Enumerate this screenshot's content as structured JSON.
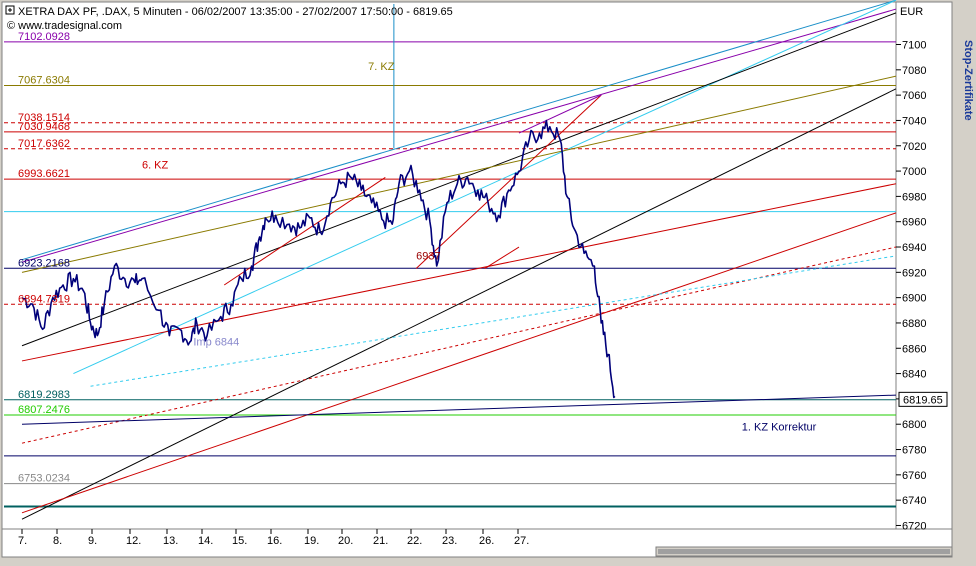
{
  "header": {
    "title": "XETRA DAX PF, .DAX, 5 Minuten - 06/02/2007 13:35:00 - 27/02/2007 17:50:00 - 6819.65",
    "source": "© www.tradesignal.com"
  },
  "side_title": "Stop-Zertifikate",
  "colors": {
    "plot_bg": "#ffffff",
    "price": "#00007a",
    "channel_blue": "#1a8fc8",
    "purple": "#8800aa",
    "cyan": "#33ccee",
    "olive": "#8a7a00",
    "red": "#cc0000",
    "dark_red": "#990000",
    "green": "#22cc00",
    "teal": "#006060",
    "navy": "#000066",
    "black": "#000000"
  },
  "chart_data": {
    "type": "line",
    "title": "XETRA DAX PF, .DAX, 5 Minuten - 06/02/2007 13:35:00 - 27/02/2007 17:50:00 - 6819.65",
    "ylabel": "EUR",
    "ylim": [
      6718,
      7132
    ],
    "y_ticks": [
      6720,
      6740,
      6760,
      6780,
      6800,
      6820,
      6840,
      6860,
      6880,
      6900,
      6920,
      6940,
      6960,
      6980,
      7000,
      7020,
      7040,
      7060,
      7080,
      7100
    ],
    "x_ticks": [
      "7.",
      "8.",
      "9.",
      "12.",
      "13.",
      "14.",
      "15.",
      "16.",
      "19.",
      "20.",
      "21.",
      "22.",
      "23.",
      "26.",
      "27."
    ],
    "x_range": [
      0,
      25.5
    ],
    "last_value_label": "6819.65",
    "price_series": {
      "name": ".DAX",
      "points": [
        [
          0,
          6900
        ],
        [
          0.3,
          6895
        ],
        [
          0.6,
          6875
        ],
        [
          0.9,
          6900
        ],
        [
          1.2,
          6910
        ],
        [
          1.5,
          6915
        ],
        [
          1.8,
          6905
        ],
        [
          2.0,
          6880
        ],
        [
          2.2,
          6870
        ],
        [
          2.4,
          6895
        ],
        [
          2.7,
          6925
        ],
        [
          3.0,
          6915
        ],
        [
          3.3,
          6912
        ],
        [
          3.5,
          6915
        ],
        [
          4.0,
          6890
        ],
        [
          4.3,
          6870
        ],
        [
          4.6,
          6875
        ],
        [
          4.9,
          6865
        ],
        [
          5.1,
          6880
        ],
        [
          5.4,
          6870
        ],
        [
          5.8,
          6885
        ],
        [
          6.1,
          6895
        ],
        [
          6.4,
          6915
        ],
        [
          6.7,
          6925
        ],
        [
          6.9,
          6945
        ],
        [
          7.1,
          6963
        ],
        [
          7.4,
          6965
        ],
        [
          7.8,
          6958
        ],
        [
          8.1,
          6955
        ],
        [
          8.4,
          6963
        ],
        [
          8.7,
          6952
        ],
        [
          9.0,
          6975
        ],
        [
          9.3,
          6990
        ],
        [
          9.6,
          6995
        ],
        [
          9.9,
          6985
        ],
        [
          10.2,
          6975
        ],
        [
          10.5,
          6962
        ],
        [
          10.8,
          6958
        ],
        [
          11.0,
          6990
        ],
        [
          11.3,
          7000
        ],
        [
          11.6,
          6985
        ],
        [
          11.9,
          6960
        ],
        [
          12.1,
          6925
        ],
        [
          12.4,
          6975
        ],
        [
          12.7,
          6990
        ],
        [
          13.0,
          6995
        ],
        [
          13.3,
          6985
        ],
        [
          13.6,
          6975
        ],
        [
          13.9,
          6965
        ],
        [
          14.2,
          6985
        ],
        [
          14.5,
          7000
        ],
        [
          14.8,
          7025
        ],
        [
          15.1,
          7030
        ],
        [
          15.4,
          7035
        ],
        [
          15.7,
          7025
        ],
        [
          15.9,
          6980
        ],
        [
          16.1,
          6955
        ],
        [
          16.4,
          6935
        ],
        [
          16.7,
          6925
        ],
        [
          16.9,
          6880
        ],
        [
          17.1,
          6855
        ],
        [
          17.3,
          6822
        ]
      ]
    },
    "horizontal_levels": [
      {
        "label": "7102.0928",
        "value": 7102.0928,
        "color": "#8800aa"
      },
      {
        "label": "7067.6304",
        "value": 7067.6304,
        "color": "#8a7a00"
      },
      {
        "label": "7038.1514",
        "value": 7038.1514,
        "color": "#cc0000",
        "dashed": true
      },
      {
        "label": "7030.9468",
        "value": 7030.9468,
        "color": "#cc0000"
      },
      {
        "label": "7017.6362",
        "value": 7017.6362,
        "color": "#cc0000",
        "dashed": true
      },
      {
        "label": "6993.6621",
        "value": 6993.6621,
        "color": "#cc0000"
      },
      {
        "label": "",
        "value": 6968,
        "color": "#33ccee"
      },
      {
        "label": "6923.2168",
        "value": 6923.2168,
        "color": "#000066"
      },
      {
        "label": "6894.7319",
        "value": 6894.7319,
        "color": "#cc0000",
        "dashed": true
      },
      {
        "label": "6819.2983",
        "value": 6819.2983,
        "color": "#006060"
      },
      {
        "label": "6807.2476",
        "value": 6807.2476,
        "color": "#22cc00"
      },
      {
        "label": "",
        "value": 6775,
        "color": "#000066"
      },
      {
        "label": "6753.0234",
        "value": 6753.0234,
        "color": "#888888"
      },
      {
        "label": "",
        "value": 6735,
        "color": "#006060",
        "thick": true
      }
    ],
    "annotations": [
      {
        "text": "7. KZ",
        "x": 10.1,
        "y": 7080,
        "color": "#8a7a00"
      },
      {
        "text": "6. KZ",
        "x": 3.5,
        "y": 7002,
        "color": "#cc0000"
      },
      {
        "text": "6937",
        "x": 11.5,
        "y": 6930,
        "color": "#990000"
      },
      {
        "text": "Imp 6844",
        "x": 5.0,
        "y": 6862,
        "color": "#8888cc"
      },
      {
        "text": "1. KZ Korrektur",
        "x": 21.0,
        "y": 6795,
        "color": "#000066"
      }
    ],
    "trend_lines": [
      {
        "color": "#1a8fc8",
        "p1": [
          0,
          6930
        ],
        "p2": [
          25.5,
          7135
        ]
      },
      {
        "color": "#8800aa",
        "p1": [
          0,
          6928
        ],
        "p2": [
          25.5,
          7128
        ]
      },
      {
        "color": "#33ccee",
        "p1": [
          1.5,
          6840
        ],
        "p2": [
          25.5,
          7135
        ]
      },
      {
        "color": "#000000",
        "p1": [
          0,
          6862
        ],
        "p2": [
          25.5,
          7125
        ]
      },
      {
        "color": "#8a7a00",
        "p1": [
          0,
          6920
        ],
        "p2": [
          25.5,
          7075
        ]
      },
      {
        "color": "#000000",
        "p1": [
          0,
          6725
        ],
        "p2": [
          25.5,
          7065
        ]
      },
      {
        "color": "#cc0000",
        "p1": [
          0,
          6730
        ],
        "p2": [
          25.5,
          6967
        ]
      },
      {
        "color": "#cc0000",
        "p1": [
          0,
          6850
        ],
        "p2": [
          25.5,
          6990
        ]
      },
      {
        "color": "#cc0000",
        "p1": [
          0,
          6785
        ],
        "p2": [
          25.5,
          6940
        ],
        "dashed": true
      },
      {
        "color": "#33ccee",
        "p1": [
          2.0,
          6830
        ],
        "p2": [
          25.5,
          6933
        ],
        "dashed": true
      },
      {
        "color": "#000066",
        "p1": [
          0,
          6800
        ],
        "p2": [
          25.5,
          6823
        ]
      },
      {
        "color": "#cc0000",
        "p1": [
          5.9,
          6910
        ],
        "p2": [
          10.6,
          6995
        ]
      },
      {
        "color": "#cc0000",
        "p1": [
          11.5,
          6923
        ],
        "p2": [
          16.9,
          7060
        ]
      },
      {
        "color": "#cc0000",
        "p1": [
          13.5,
          6923
        ],
        "p2": [
          14.5,
          6940
        ]
      },
      {
        "color": "#8800aa",
        "p1": [
          14.5,
          7030
        ],
        "p2": [
          16.9,
          7060
        ]
      }
    ],
    "vertical_line": {
      "x": 10.85,
      "y_from": 7132,
      "y_to": 7018,
      "color": "#1a8fc8"
    },
    "legend": "none",
    "grid": false
  }
}
